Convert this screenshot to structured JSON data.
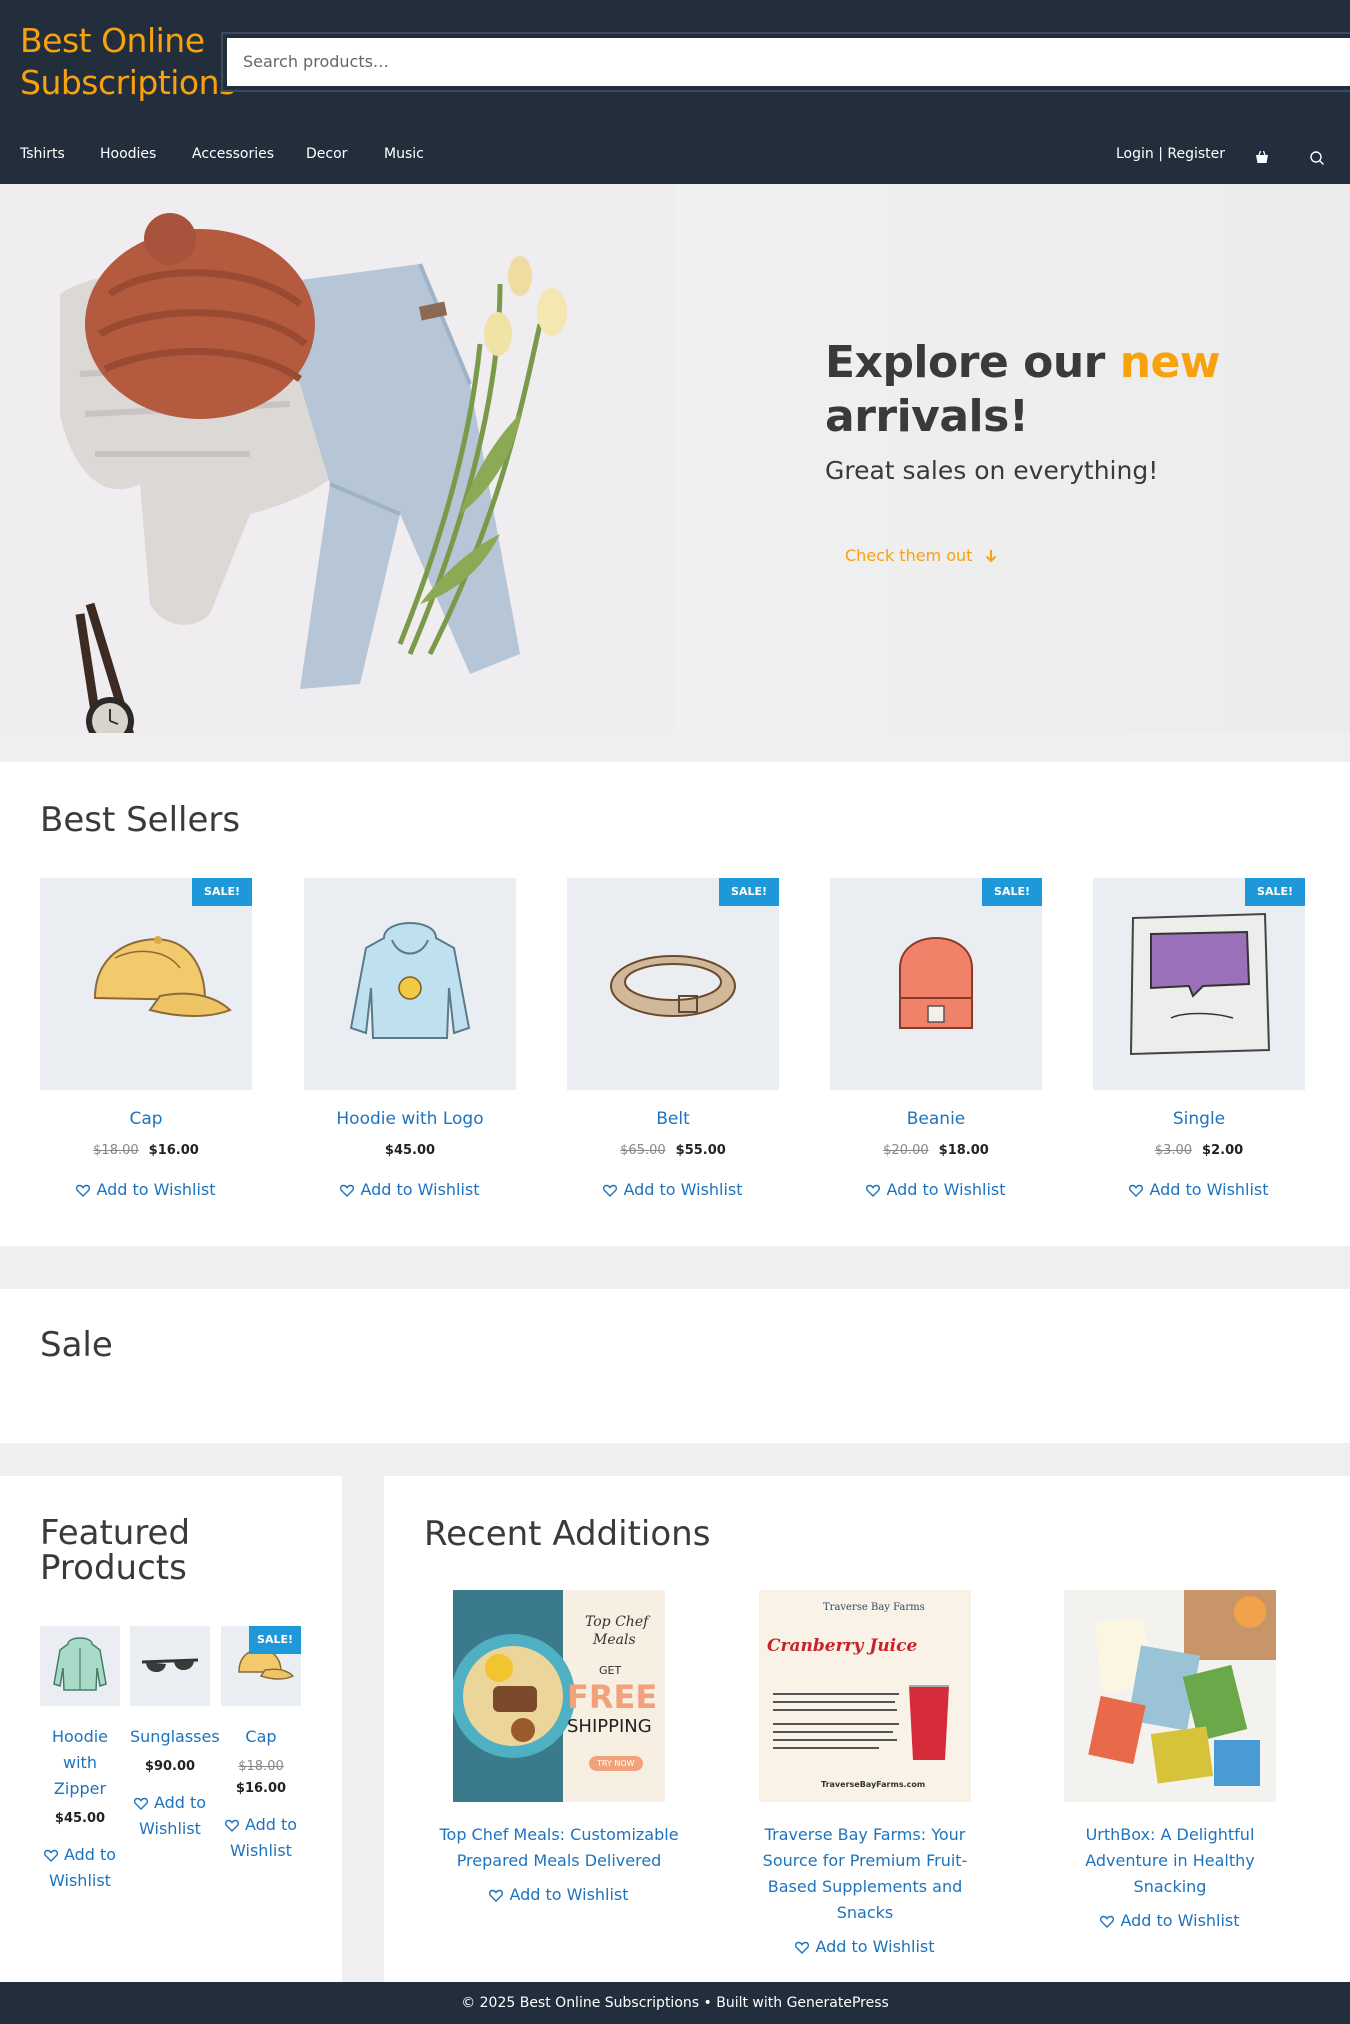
{
  "site": {
    "logo": "Best Online Subscriptions"
  },
  "search": {
    "placeholder": "Search products…"
  },
  "nav": {
    "items": [
      "Tshirts",
      "Hoodies",
      "Accessories",
      "Decor",
      "Music"
    ],
    "account": "Login | Register",
    "icons": [
      "cart-icon",
      "search-icon"
    ]
  },
  "hero": {
    "title_start": "Explore our ",
    "title_accent": "new",
    "title_end": "arrivals!",
    "subtitle": "Great sales on everything!",
    "button": "Check them out"
  },
  "best_sellers": {
    "title": "Best Sellers",
    "products": [
      {
        "name": "Cap",
        "old_price": "$18.00",
        "price": "$16.00",
        "sale": "SALE!",
        "wishlist": "Add to Wishlist"
      },
      {
        "name": "Hoodie with Logo",
        "old_price": "",
        "price": "$45.00",
        "sale": "",
        "wishlist": "Add to Wishlist"
      },
      {
        "name": "Belt",
        "old_price": "$65.00",
        "price": "$55.00",
        "sale": "SALE!",
        "wishlist": "Add to Wishlist"
      },
      {
        "name": "Beanie",
        "old_price": "$20.00",
        "price": "$18.00",
        "sale": "SALE!",
        "wishlist": "Add to Wishlist"
      },
      {
        "name": "Single",
        "old_price": "$3.00",
        "price": "$2.00",
        "sale": "SALE!",
        "wishlist": "Add to Wishlist"
      }
    ]
  },
  "sale_section": {
    "title": "Sale"
  },
  "featured": {
    "title_line1": "Featured",
    "title_line2": "Products",
    "products": [
      {
        "name": "Hoodie with Zipper",
        "old_price": "",
        "price": "$45.00",
        "sale": "",
        "wishlist": "Add to Wishlist"
      },
      {
        "name": "Sunglasses",
        "old_price": "",
        "price": "$90.00",
        "sale": "",
        "wishlist": "Add to Wishlist"
      },
      {
        "name": "Cap",
        "old_price": "$18.00",
        "price": "$16.00",
        "sale": "SALE!",
        "wishlist": "Add to Wishlist"
      }
    ]
  },
  "recent": {
    "title": "Recent Additions",
    "items": [
      {
        "name": "Top Chef Meals: Customizable Prepared Meals Delivered",
        "wishlist": "Add to Wishlist",
        "img_text": [
          "Top Chef",
          "Meals",
          "GET",
          "FREE",
          "SHIPPING",
          "TRY NOW"
        ]
      },
      {
        "name": "Traverse Bay Farms: Your Source for Premium Fruit-Based Supplements and Snacks",
        "wishlist": "Add to Wishlist",
        "img_text": [
          "Traverse Bay Farms",
          "Cranberry Juice",
          "TraverseBayFarms.com"
        ]
      },
      {
        "name": "UrthBox: A Delightful Adventure in Healthy Snacking",
        "wishlist": "Add to Wishlist",
        "img_text": []
      }
    ]
  },
  "footer": {
    "text": "© 2025 Best Online Subscriptions • Built with GeneratePress"
  },
  "colors": {
    "header_bg": "#232e3d",
    "accent": "#f7a10d",
    "link": "#1e73be",
    "sale_badge": "#1e98d8"
  }
}
